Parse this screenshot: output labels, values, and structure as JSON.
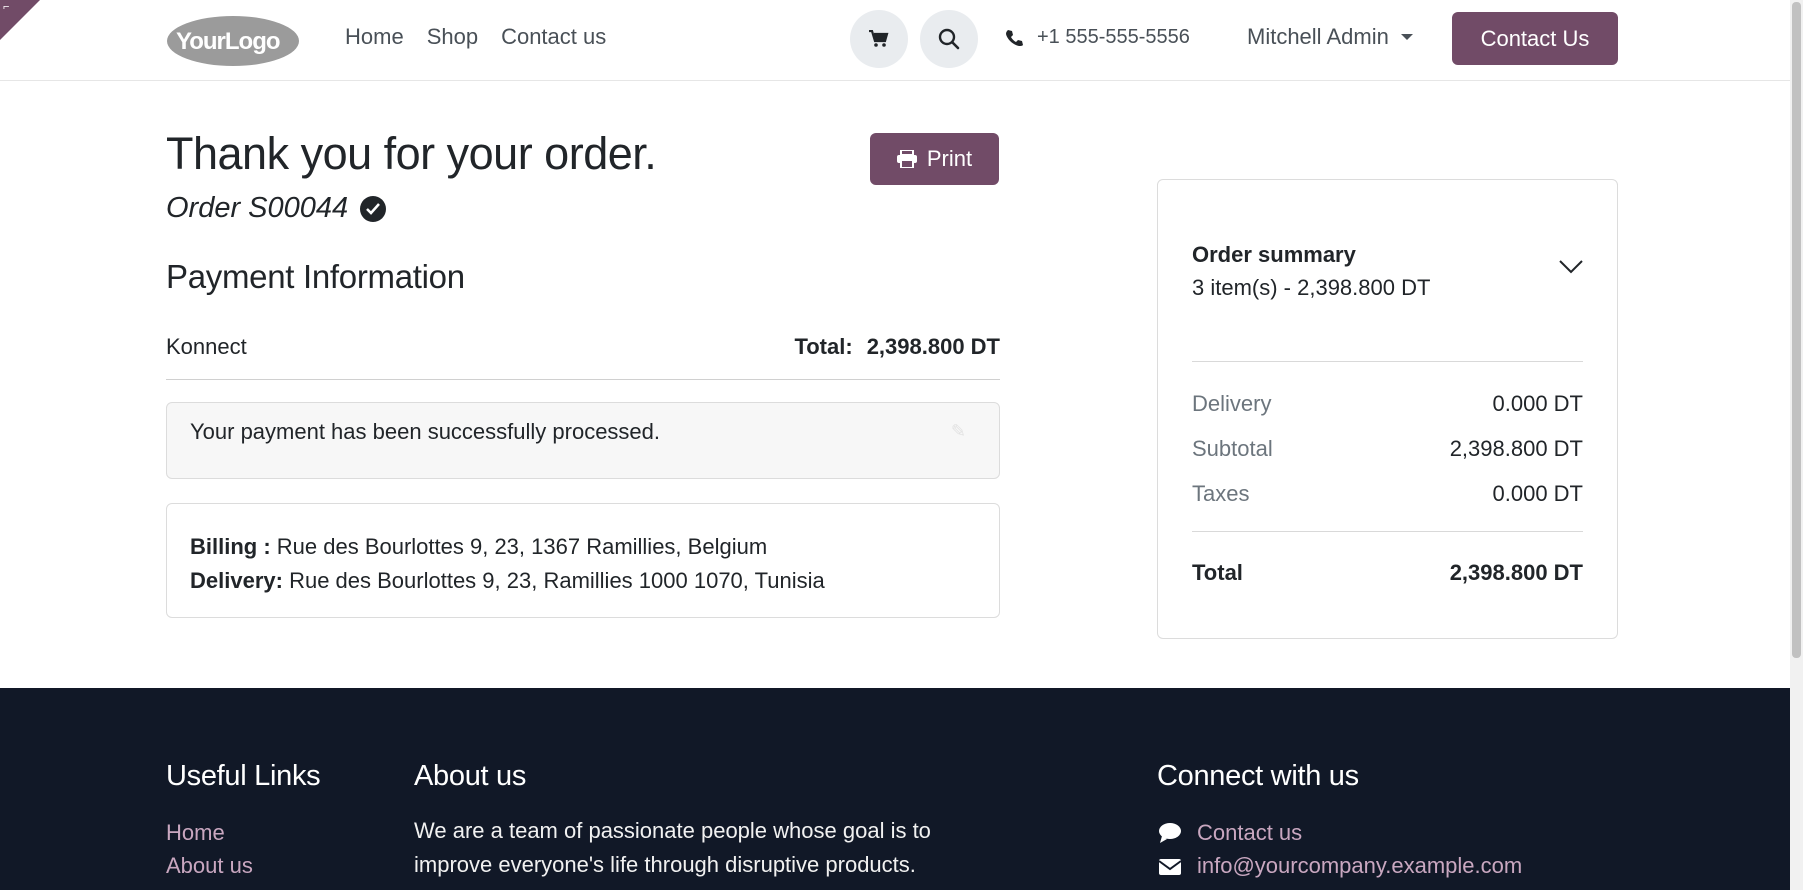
{
  "header": {
    "logo_text": "YourLogo",
    "nav": [
      "Home",
      "Shop",
      "Contact us"
    ],
    "phone": "+1 555-555-5556",
    "user": "Mitchell Admin",
    "contact_button": "Contact Us"
  },
  "main": {
    "title": "Thank you for your order.",
    "print_button": "Print",
    "order_ref": "Order S00044",
    "payment_heading": "Payment Information",
    "payment_method": "Konnect",
    "total_label": "Total:",
    "total_value": "2,398.800 DT",
    "alert": "Your payment has been successfully processed.",
    "billing_label": "Billing :",
    "billing_address": " Rue des Bourlottes 9, 23, 1367 Ramillies, Belgium",
    "delivery_label": "Delivery:",
    "delivery_address": " Rue des Bourlottes 9, 23, Ramillies 1000 1070, Tunisia"
  },
  "summary": {
    "title": "Order summary",
    "subtitle": "3 item(s) -  2,398.800 DT",
    "rows": [
      {
        "label": "Delivery",
        "value": "0.000 DT"
      },
      {
        "label": "Subtotal",
        "value": "2,398.800 DT"
      },
      {
        "label": "Taxes",
        "value": "0.000 DT"
      }
    ],
    "total_label": "Total",
    "total_value": "2,398.800 DT"
  },
  "footer": {
    "useful_links_heading": "Useful Links",
    "useful_links": [
      "Home",
      "About us"
    ],
    "about_heading": "About us",
    "about_text": "We are a team of passionate people whose goal is to improve everyone's life through disruptive products.",
    "connect_heading": "Connect with us",
    "connect_links": [
      "Contact us",
      "info@yourcompany.example.com"
    ]
  },
  "colors": {
    "brand": "#714b67",
    "footer_bg": "#111827",
    "footer_link": "#c9a7c0"
  }
}
